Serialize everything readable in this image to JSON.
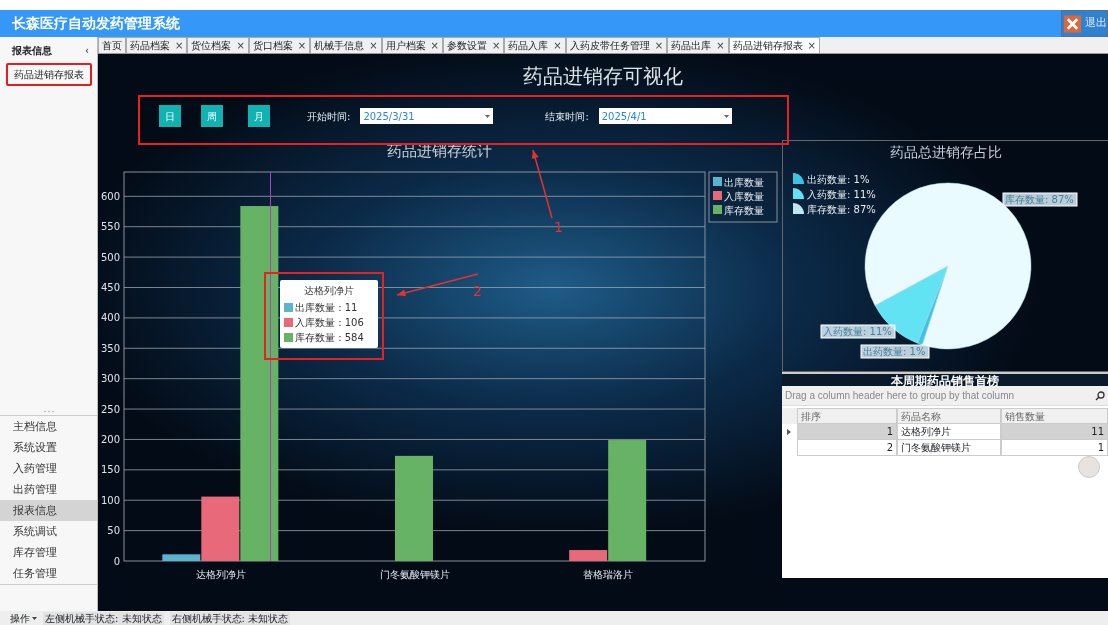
{
  "title_bar": {
    "title": "长森医疗自动发药管理系统",
    "exit_label": "退出"
  },
  "sidebar": {
    "header": "报表信息",
    "collapse": "‹",
    "items": [
      {
        "label": "药品进销存报表",
        "selected": true
      }
    ],
    "nav": [
      {
        "label": "主档信息",
        "selected": false
      },
      {
        "label": "系统设置",
        "selected": false
      },
      {
        "label": "入药管理",
        "selected": false
      },
      {
        "label": "出药管理",
        "selected": false
      },
      {
        "label": "报表信息",
        "selected": true
      },
      {
        "label": "系统调试",
        "selected": false
      },
      {
        "label": "库存管理",
        "selected": false
      },
      {
        "label": "任务管理",
        "selected": false
      }
    ]
  },
  "tabs": [
    {
      "label": "首页",
      "selected": false
    },
    {
      "label": "药品档案",
      "close": "×",
      "selected": false
    },
    {
      "label": "货位档案",
      "close": "×",
      "selected": false
    },
    {
      "label": "货口档案",
      "close": "×",
      "selected": false
    },
    {
      "label": "机械手信息",
      "close": "×",
      "selected": false
    },
    {
      "label": "用户档案",
      "close": "×",
      "selected": false
    },
    {
      "label": "参数设置",
      "close": "×",
      "selected": false
    },
    {
      "label": "药品入库",
      "close": "×",
      "selected": false
    },
    {
      "label": "入药皮带任务管理",
      "close": "×",
      "selected": false
    },
    {
      "label": "药品出库",
      "close": "×",
      "selected": false
    },
    {
      "label": "药品进销存报表",
      "close": "×",
      "selected": true
    }
  ],
  "dashboard": {
    "title": "药品进销存可视化",
    "period_buttons": [
      {
        "label": "日"
      },
      {
        "label": "周"
      },
      {
        "label": "月"
      }
    ],
    "start": {
      "label": "开始时间:",
      "value": "2025/3/31"
    },
    "end": {
      "label": "结束时间:",
      "value": "2025/4/1"
    },
    "bar_chart": {
      "chart_data": {
        "type": "bar",
        "title": "药品进销存统计",
        "categories": [
          "达格列净片",
          "门冬氨酸钾镁片",
          "替格瑞洛片"
        ],
        "series": [
          {
            "name": "出库数量",
            "color": "#5ab4cf",
            "values": [
              11,
              null,
              null
            ]
          },
          {
            "name": "入库数量",
            "color": "#e8697a",
            "values": [
              106,
              null,
              18
            ]
          },
          {
            "name": "库存数量",
            "color": "#66b366",
            "values": [
              584,
              173,
              199
            ]
          }
        ],
        "grid": true,
        "legend": true,
        "ylim": [
          0,
          640
        ],
        "yticks": [
          0,
          50,
          100,
          150,
          200,
          250,
          300,
          350,
          400,
          450,
          500,
          550,
          600
        ]
      },
      "tooltip": {
        "title": "达格列净片",
        "rows": [
          {
            "label": "出库数量 : 11",
            "color": "#5ab4cf"
          },
          {
            "label": "入库数量 : 106",
            "color": "#e8697a"
          },
          {
            "label": "库存数量 : 584",
            "color": "#66b366"
          }
        ]
      }
    },
    "pie_chart": {
      "chart_data": {
        "type": "pie",
        "title": "药品总进销存占比",
        "categories": [
          "出药数量",
          "入药数量",
          "库存数量"
        ],
        "values": [
          1,
          11,
          87
        ],
        "colors": [
          "#3cc3e3",
          "#62e3f4",
          "#eafbff"
        ],
        "value_labels": [
          ": 1%",
          ": 11%",
          ": 87%"
        ]
      },
      "legend": [
        "出药数量: 1%",
        "入药数量: 11%",
        "库存数量: 87%"
      ]
    },
    "ranking": {
      "title": "本周期药品销售首榜",
      "group_hint": "Drag a column header here to group by that column",
      "columns": [
        "排序",
        "药品名称",
        "销售数量"
      ],
      "rows": [
        {
          "cells": [
            "1",
            "达格列净片",
            "11"
          ],
          "focused": true
        },
        {
          "cells": [
            "2",
            "门冬氨酸钾镁片",
            "1"
          ],
          "focused": false
        }
      ]
    }
  },
  "callouts": [
    {
      "number": "1"
    },
    {
      "number": "2"
    }
  ],
  "status_bar": {
    "menu": "操作",
    "items": [
      "左侧机械手状态: 未知状态",
      "右侧机械手状态: 未知状态"
    ]
  }
}
